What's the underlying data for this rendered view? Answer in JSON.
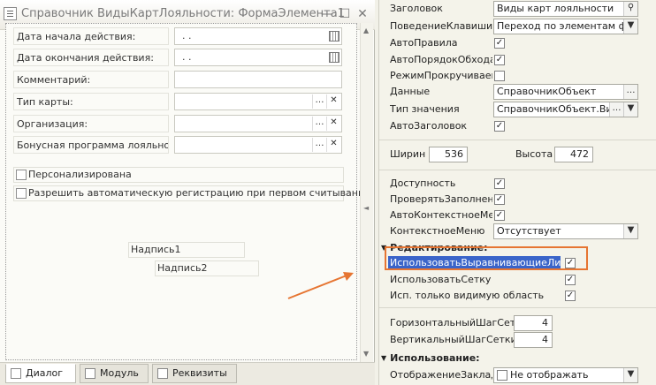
{
  "window": {
    "title": "Справочник ВидыКартЛояльности: ФормаЭлемента1"
  },
  "form": {
    "labels": {
      "start_date": "Дата начала действия:",
      "end_date": "Дата окончания действия:",
      "comment": "Комментарий:",
      "card_type": "Тип карты:",
      "organization": "Организация:",
      "bonus_program": "Бонусная программа лояльности:"
    },
    "date_placeholder": ". .",
    "checkboxes": {
      "personalized": "Персонализирована",
      "auto_registration": "Разрешить автоматическую регистрацию при первом считывании"
    },
    "captions": {
      "caption1": "Надпись1",
      "caption2": "Надпись2"
    }
  },
  "tabs": [
    {
      "label": "Диалог"
    },
    {
      "label": "Модуль"
    },
    {
      "label": "Реквизиты"
    }
  ],
  "props": {
    "title_label": "Заголовок",
    "title_value": "Виды карт лояльности",
    "keyboard_label": "ПоведениеКлавишиEnter",
    "keyboard_value": "Переход по элементам формы",
    "autorules_label": "АвтоПравила",
    "autotab_label": "АвтоПорядокОбхода",
    "scrollmode_label": "РежимПрокручиваемых",
    "data_label": "Данные",
    "data_value": "СправочникОбъект",
    "valuetype_label": "Тип значения",
    "valuetype_value": "СправочникОбъект.Виды",
    "autotitle_label": "АвтоЗаголовок",
    "width_label": "Ширина",
    "width_value": "536",
    "height_label": "Высота",
    "height_value": "472",
    "enabled_label": "Доступность",
    "checkfill_label": "ПроверятьЗаполнение",
    "autocontext_label": "АвтоКонтекстноеМеню",
    "context_label": "КонтекстноеМеню",
    "context_value": "Отсутствует",
    "group_edit": "Редактирование:",
    "align_lines_label": "ИспользоватьВыравнивающиеЛинии",
    "grid_label": "ИспользоватьСетку",
    "visible_only_label": "Исп. только видимую область",
    "hgrid_label": "ГоризонтальныйШагСетки",
    "hgrid_value": "4",
    "vgrid_label": "ВертикальныйШагСетки",
    "vgrid_value": "4",
    "group_use": "Использование:",
    "bookmarks_label": "ОтображениеЗакладок",
    "bookmarks_value": "Не отображать",
    "check": "✓"
  },
  "colors": {
    "highlight": "#3a64c9",
    "annotation": "#e67532"
  }
}
